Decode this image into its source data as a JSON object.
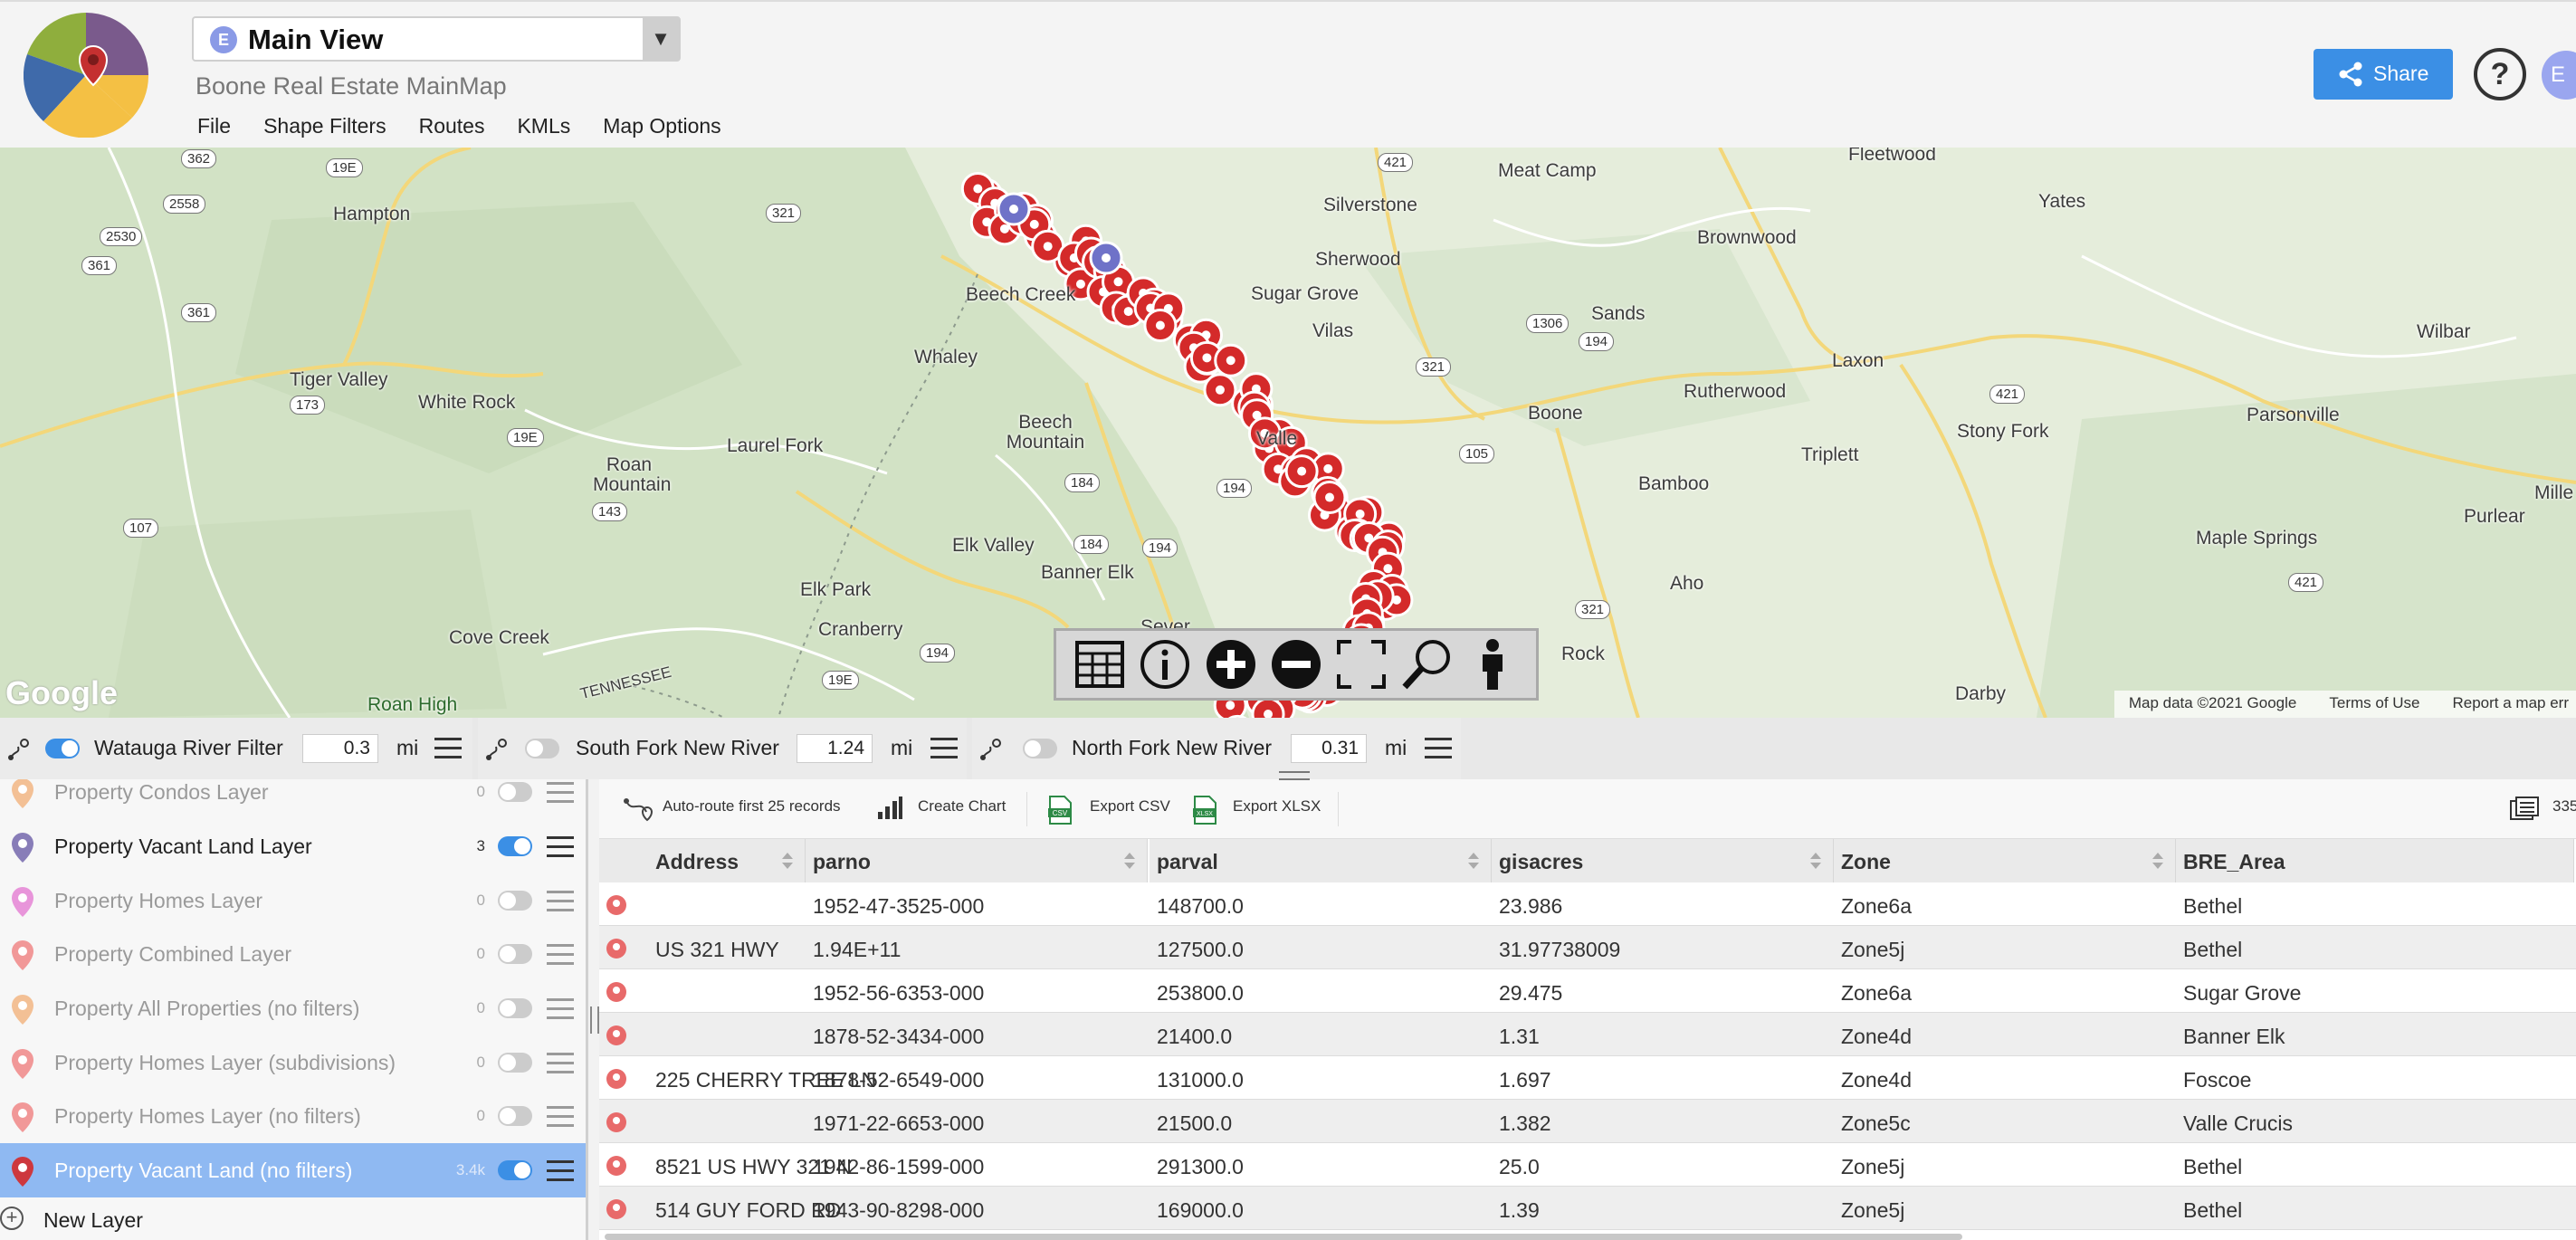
{
  "header": {
    "view_badge": "E",
    "view_title": "Main View",
    "view_dropdown_arrow": "▼",
    "map_name": "Boone Real Estate MainMap",
    "menu": [
      "File",
      "Shape Filters",
      "Routes",
      "KMLs",
      "Map Options"
    ],
    "share_label": "Share",
    "help_label": "?",
    "avatar_initial": "E"
  },
  "map": {
    "places": [
      "Hampton",
      "Tiger Valley",
      "White Rock",
      "Roan Mountain",
      "Laurel Fork",
      "Whaley",
      "Beech Creek",
      "Beech Mountain",
      "Elk Valley",
      "Banner Elk",
      "Elk Park",
      "Cranberry",
      "Cove Creek",
      "Roan High",
      "Meat Camp",
      "Silverstone",
      "Sherwood",
      "Sugar Grove",
      "Vilas",
      "Sands",
      "Brownwood",
      "Fleetwood",
      "Yates",
      "Laxon",
      "Rutherwood",
      "Boone",
      "Triplett",
      "Bamboo",
      "Aho",
      "Stony Fork",
      "Parsonville",
      "Maple Springs",
      "Wilbar",
      "Purlear",
      "Darby",
      "Valle",
      "Sever",
      "Rock",
      "TENNESSEE",
      "Mille"
    ],
    "shields": [
      "362",
      "19E",
      "2558",
      "2530",
      "361",
      "361",
      "173",
      "19E",
      "143",
      "107",
      "321",
      "184",
      "184",
      "194",
      "194",
      "194",
      "421",
      "1306",
      "194",
      "321",
      "105",
      "421",
      "421",
      "321",
      "19E",
      "194"
    ],
    "google_logo": "Google",
    "attribution": [
      "Map data ©2021 Google",
      "Terms of Use",
      "Report a map err"
    ],
    "toolbar_tools": [
      "table-icon",
      "info-icon",
      "zoom-in-icon",
      "zoom-out-icon",
      "fullscreen-icon",
      "search-icon",
      "street-view-icon"
    ]
  },
  "filters": [
    {
      "name": "Watauga River Filter",
      "enabled": true,
      "distance": "0.3",
      "unit": "mi"
    },
    {
      "name": "South Fork New River",
      "enabled": false,
      "distance": "1.24",
      "unit": "mi"
    },
    {
      "name": "North Fork New River",
      "enabled": false,
      "distance": "0.31",
      "unit": "mi"
    }
  ],
  "layers": [
    {
      "name": "Property Condos Layer",
      "count": "0",
      "enabled": false,
      "pin_color": "#f2b98a"
    },
    {
      "name": "Property Vacant Land Layer",
      "count": "3",
      "enabled": true,
      "pin_color": "#7b6fb0"
    },
    {
      "name": "Property Homes Layer",
      "count": "0",
      "enabled": false,
      "pin_color": "#e58ad6"
    },
    {
      "name": "Property Combined Layer",
      "count": "0",
      "enabled": false,
      "pin_color": "#ef8d8d"
    },
    {
      "name": "Property All Properties (no filters)",
      "count": "0",
      "enabled": false,
      "pin_color": "#f2b98a"
    },
    {
      "name": "Property Homes Layer (subdivisions)",
      "count": "0",
      "enabled": false,
      "pin_color": "#ef8d8d"
    },
    {
      "name": "Property Homes Layer (no filters)",
      "count": "0",
      "enabled": false,
      "pin_color": "#ef8d8d"
    },
    {
      "name": "Property Vacant Land (no filters)",
      "count": "3.4k",
      "enabled": true,
      "pin_color": "#d42a2a"
    }
  ],
  "new_layer_label": "New Layer",
  "table_toolbar": {
    "auto_route": "Auto-route first 25 records",
    "create_chart": "Create Chart",
    "export_csv": "Export CSV",
    "export_xlsx": "Export XLSX",
    "record_count": "335"
  },
  "table": {
    "columns": [
      "Address",
      "parno",
      "parval",
      "gisacres",
      "Zone",
      "BRE_Area"
    ],
    "rows": [
      [
        "",
        "1952-47-3525-000",
        "148700.0",
        "23.986",
        "Zone6a",
        "Bethel"
      ],
      [
        "US 321 HWY",
        "1.94E+11",
        "127500.0",
        "31.97738009",
        "Zone5j",
        "Bethel"
      ],
      [
        "",
        "1952-56-6353-000",
        "253800.0",
        "29.475",
        "Zone6a",
        "Sugar Grove"
      ],
      [
        "",
        "1878-52-3434-000",
        "21400.0",
        "1.31",
        "Zone4d",
        "Banner Elk"
      ],
      [
        "225 CHERRY TREE LN",
        "1878-52-6549-000",
        "131000.0",
        "1.697",
        "Zone4d",
        "Foscoe"
      ],
      [
        "",
        "1971-22-6653-000",
        "21500.0",
        "1.382",
        "Zone5c",
        "Valle Crucis"
      ],
      [
        "8521 US HWY 321 N",
        "1942-86-1599-000",
        "291300.0",
        "25.0",
        "Zone5j",
        "Bethel"
      ],
      [
        "514 GUY FORD RD",
        "1943-90-8298-000",
        "169000.0",
        "1.39",
        "Zone5j",
        "Bethel"
      ]
    ]
  },
  "colors": {
    "accent": "#3b8fe5",
    "marker": "#d42a2a",
    "selected_layer": "#8fb9f2"
  }
}
